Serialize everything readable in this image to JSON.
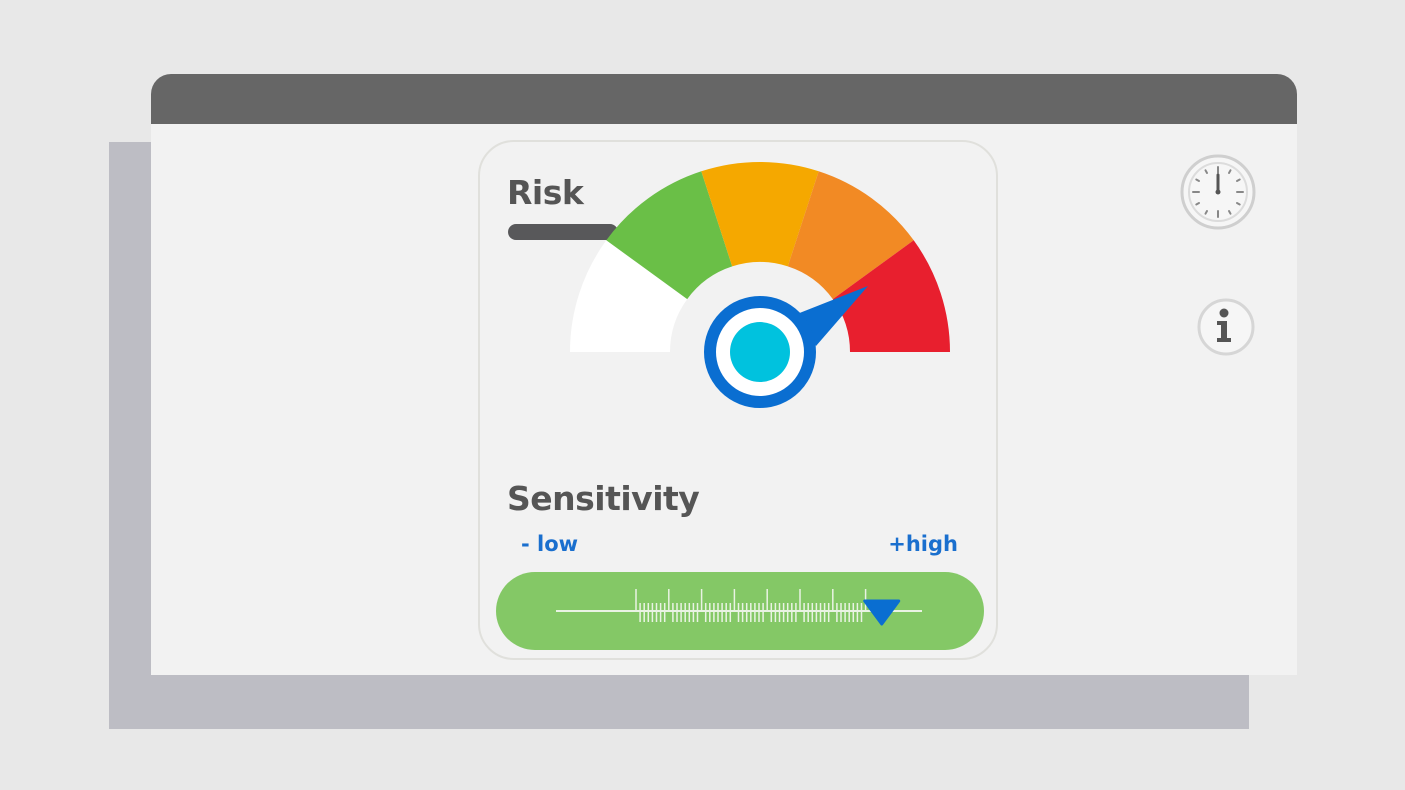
{
  "risk": {
    "label": "Risk",
    "gauge_colors": [
      "#ffffff",
      "#6abf47",
      "#f5a800",
      "#f28a24",
      "#e81f2e"
    ],
    "needle_color": "#0a6ed1",
    "hub_color": "#00c2de"
  },
  "sensitivity": {
    "label": "Sensitivity",
    "low_label": "- low",
    "high_label": "+high",
    "level_fraction": 0.89,
    "track_color": "#84c866",
    "handle_color": "#0a6ed1"
  },
  "icons": {
    "clock": "clock-icon",
    "info": "info-icon"
  }
}
